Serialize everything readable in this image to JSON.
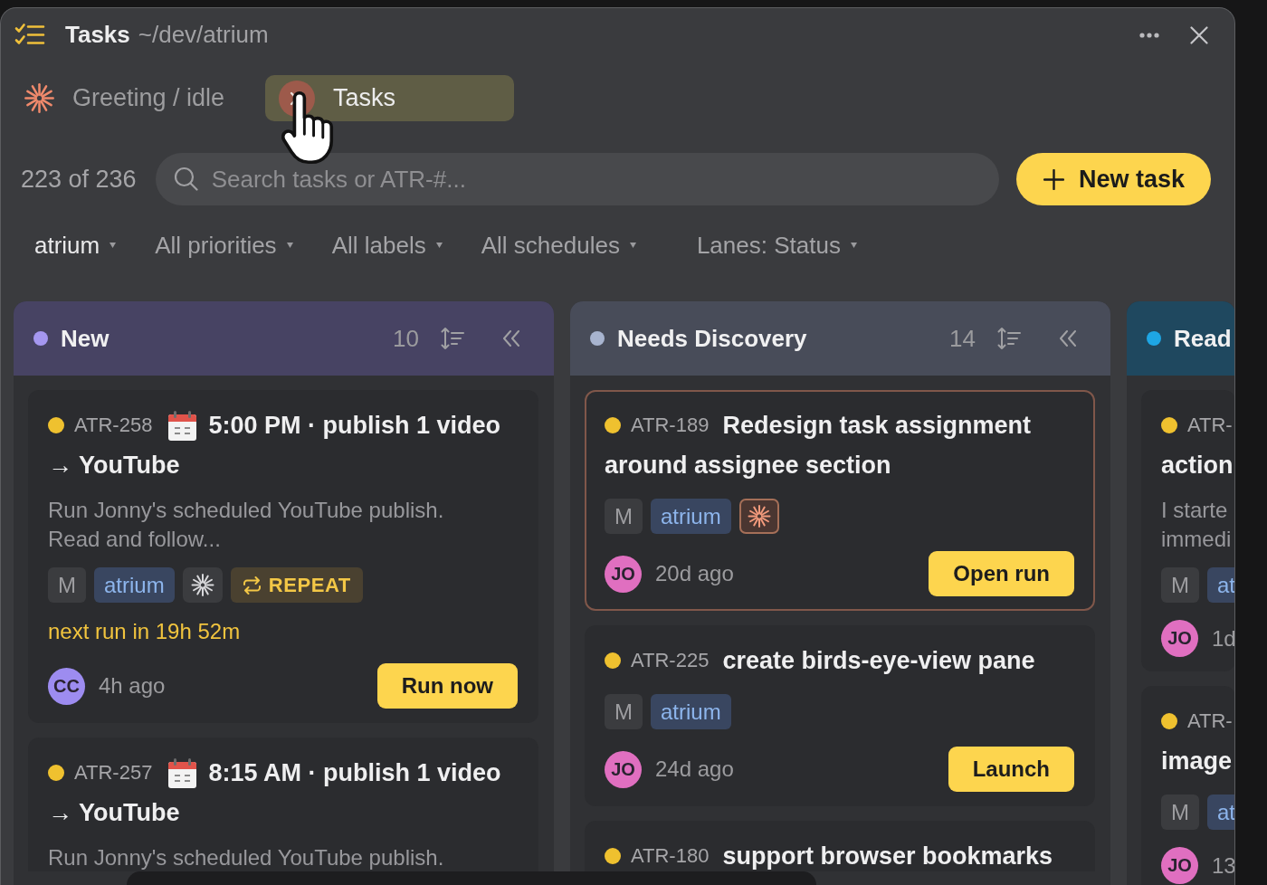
{
  "window": {
    "title": "Tasks",
    "path": "~/dev/atrium"
  },
  "tabs": [
    {
      "label": "Greeting / idle",
      "kind": "agent",
      "selected": false
    },
    {
      "label": "Tasks",
      "kind": "tasks",
      "selected": true
    }
  ],
  "toolbar": {
    "count": "223 of 236",
    "search": {
      "placeholder": "Search tasks or ATR-#..."
    },
    "new_task": "New task"
  },
  "filters": [
    {
      "label": "atrium",
      "kind": "filter",
      "active": true
    },
    {
      "label": "All priorities",
      "kind": "filter",
      "active": false
    },
    {
      "label": "All labels",
      "kind": "filter",
      "active": false
    },
    {
      "label": "All schedules",
      "kind": "filter",
      "active": false
    },
    {
      "label": "Lanes: Status",
      "kind": "grouping",
      "active": false
    }
  ],
  "lanes": [
    {
      "name": "New",
      "color": "#a597f0",
      "count": "10",
      "cards": [
        {
          "id": "ATR-258",
          "color": "#efc12f",
          "scheduled": true,
          "highlighted": false,
          "title": [
            "5:00 PM · publish 1 video",
            "→ YouTube"
          ],
          "description": [
            "Run Jonny's scheduled YouTube publish.",
            "Read and follow..."
          ],
          "tags": [
            {
              "kind": "priority",
              "label": "M"
            },
            {
              "kind": "project",
              "label": "atrium"
            },
            {
              "kind": "agent",
              "active": false
            },
            {
              "kind": "repeat",
              "label": "REPEAT"
            }
          ],
          "next_run": "next run in 19h 52m",
          "assignee": {
            "initials": "CC",
            "color": "#9d8cf0"
          },
          "age": "4h ago",
          "action": "Run now"
        },
        {
          "id": "ATR-257",
          "color": "#efc12f",
          "scheduled": true,
          "highlighted": false,
          "title": [
            "8:15 AM · publish 1 video",
            "→ YouTube"
          ],
          "description": [
            "Run Jonny's scheduled YouTube publish."
          ]
        }
      ]
    },
    {
      "name": "Needs Discovery",
      "color": "#a8b4cf",
      "count": "14",
      "cards": [
        {
          "id": "ATR-189",
          "color": "#efc12f",
          "scheduled": false,
          "highlighted": true,
          "title": [
            "Redesign task assignment",
            "around assignee section"
          ],
          "tags": [
            {
              "kind": "priority",
              "label": "M"
            },
            {
              "kind": "project",
              "label": "atrium"
            },
            {
              "kind": "agent",
              "active": true
            }
          ],
          "assignee": {
            "initials": "JO",
            "color": "#e06fc0"
          },
          "age": "20d ago",
          "action": "Open run"
        },
        {
          "id": "ATR-225",
          "color": "#efc12f",
          "scheduled": false,
          "highlighted": false,
          "title": [
            "create birds-eye-view pane"
          ],
          "tags": [
            {
              "kind": "priority",
              "label": "M"
            },
            {
              "kind": "project",
              "label": "atrium"
            }
          ],
          "assignee": {
            "initials": "JO",
            "color": "#e06fc0"
          },
          "age": "24d ago",
          "action": "Launch"
        },
        {
          "id": "ATR-180",
          "color": "#efc12f",
          "scheduled": false,
          "highlighted": false,
          "title": [
            "support browser bookmarks"
          ]
        }
      ]
    },
    {
      "name": "Read",
      "color": "#1ea6e4",
      "cards": [
        {
          "id": "ATR-",
          "color": "#efc12f",
          "scheduled": false,
          "highlighted": false,
          "title": [
            "action"
          ],
          "description": [
            "I starte",
            "immedi"
          ],
          "tags": [
            {
              "kind": "priority",
              "label": "M"
            },
            {
              "kind": "project",
              "label": "at"
            }
          ],
          "assignee": {
            "initials": "JO",
            "color": "#e06fc0"
          },
          "age": "1d"
        },
        {
          "id": "ATR-",
          "color": "#efc12f",
          "scheduled": false,
          "highlighted": false,
          "title": [
            "image"
          ],
          "tags": [
            {
              "kind": "priority",
              "label": "M"
            },
            {
              "kind": "project",
              "label": "at"
            }
          ],
          "assignee": {
            "initials": "JO",
            "color": "#e06fc0"
          },
          "age": "13"
        }
      ]
    }
  ]
}
